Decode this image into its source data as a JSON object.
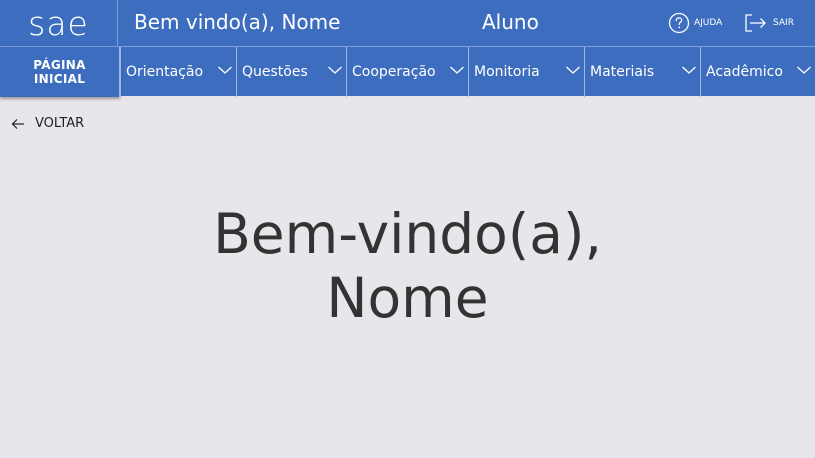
{
  "header": {
    "logo_text": "sae",
    "welcome_text": "Bem vindo(a), Nome",
    "role_text": "Aluno",
    "help_label": "AJUDA",
    "logout_label": "SAIR"
  },
  "nav": {
    "home_label_line1": "PÁGINA",
    "home_label_line2": "INICIAL",
    "items": [
      {
        "label": "Orientação"
      },
      {
        "label": "Questões"
      },
      {
        "label": "Cooperação"
      },
      {
        "label": "Monitoria"
      },
      {
        "label": "Materiais"
      },
      {
        "label": "Acadêmico"
      }
    ]
  },
  "back_label": "VOLTAR",
  "hero": {
    "line1": "Bem-vindo(a),",
    "line2": "Nome"
  },
  "colors": {
    "brand_blue": "#3d6dbf",
    "background": "#e8e6ea",
    "text_dark": "#333333"
  },
  "icons": {
    "help": "question-circle-icon",
    "logout": "logout-arrow-icon",
    "back": "arrow-left-icon",
    "dropdown": "chevron-down-icon"
  }
}
